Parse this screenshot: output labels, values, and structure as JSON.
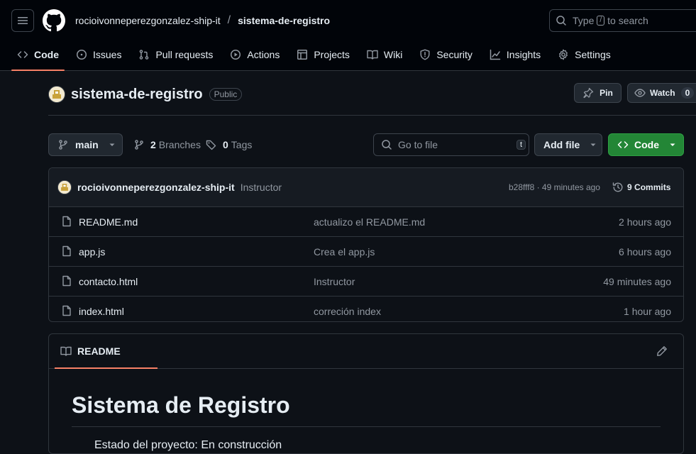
{
  "header": {
    "owner": "rocioivonneperezgonzalez-ship-it",
    "separator": "/",
    "repo": "sistema-de-registro",
    "search_prefix": "Type",
    "search_key": "/",
    "search_suffix": "to search"
  },
  "nav_tabs": [
    {
      "label": "Code",
      "icon": "code-icon"
    },
    {
      "label": "Issues",
      "icon": "issue-opened-icon"
    },
    {
      "label": "Pull requests",
      "icon": "git-pull-request-icon"
    },
    {
      "label": "Actions",
      "icon": "play-icon"
    },
    {
      "label": "Projects",
      "icon": "table-icon"
    },
    {
      "label": "Wiki",
      "icon": "book-icon"
    },
    {
      "label": "Security",
      "icon": "shield-icon"
    },
    {
      "label": "Insights",
      "icon": "graph-icon"
    },
    {
      "label": "Settings",
      "icon": "gear-icon"
    }
  ],
  "repo": {
    "title": "sistema-de-registro",
    "visibility": "Public",
    "pin_label": "Pin",
    "watch_label": "Watch",
    "watch_count": "0"
  },
  "toolbar": {
    "branch": "main",
    "branches_count": "2",
    "branches_label": "Branches",
    "tags_count": "0",
    "tags_label": "Tags",
    "goto_placeholder": "Go to file",
    "goto_key": "t",
    "add_file_label": "Add file",
    "code_label": "Code"
  },
  "latest_commit": {
    "author": "rocioivonneperezgonzalez-ship-it",
    "message": "Instructor",
    "hash_time": "b28fff8 · 49 minutes ago",
    "commits_count": "9",
    "commits_label": "Commits"
  },
  "files": [
    {
      "name": "README.md",
      "message": "actualizo el README.md",
      "time": "2 hours ago"
    },
    {
      "name": "app.js",
      "message": "Crea el app.js",
      "time": "6 hours ago"
    },
    {
      "name": "contacto.html",
      "message": "Instructor",
      "time": "49 minutes ago"
    },
    {
      "name": "index.html",
      "message": "correción index",
      "time": "1 hour ago"
    }
  ],
  "readme": {
    "tab_label": "README",
    "heading": "Sistema de Registro",
    "first_line": "Estado del proyecto: En construcción"
  },
  "colors": {
    "background": "#0d1117",
    "header_bg": "#010409",
    "accent_underline": "#f78166",
    "code_button": "#238636"
  }
}
